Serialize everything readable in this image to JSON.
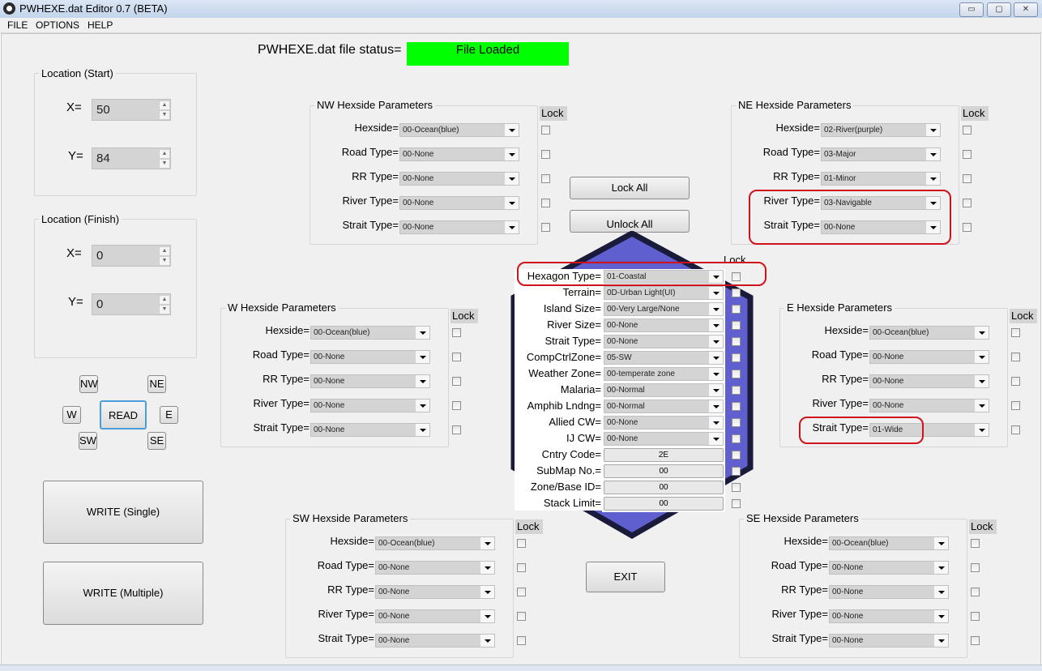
{
  "window": {
    "title": "PWHEXE.dat Editor 0.7 (BETA)",
    "minimize": "▭",
    "maximize": "▢",
    "close": "✕"
  },
  "menu": [
    "FILE",
    "OPTIONS",
    "HELP"
  ],
  "file_status": {
    "label": "PWHEXE.dat file status=",
    "value": "File Loaded",
    "color": "#00ff00"
  },
  "location_start": {
    "title": "Location (Start)",
    "x_label": "X=",
    "x": "50",
    "y_label": "Y=",
    "y": "84"
  },
  "location_finish": {
    "title": "Location (Finish)",
    "x_label": "X=",
    "x": "0",
    "y_label": "Y=",
    "y": "0"
  },
  "nav": {
    "nw": "NW",
    "ne": "NE",
    "w": "W",
    "read": "READ",
    "e": "E",
    "sw": "SW",
    "se": "SE"
  },
  "write_single": "WRITE (Single)",
  "write_multiple": "WRITE (Multiple)",
  "lock_all": "Lock All",
  "unlock_all": "Unlock All",
  "exit": "EXIT",
  "field_labels": [
    "Hexside=",
    "Road Type=",
    "RR Type=",
    "River Type=",
    "Strait Type="
  ],
  "lock_label": "Lock",
  "hexsides": {
    "nw": {
      "title": "NW Hexside Parameters",
      "values": [
        "00-Ocean(blue)",
        "00-None",
        "00-None",
        "00-None",
        "00-None"
      ]
    },
    "ne": {
      "title": "NE Hexside Parameters",
      "values": [
        "02-River(purple)",
        "03-Major",
        "01-Minor",
        "03-Navigable",
        "00-None"
      ]
    },
    "w": {
      "title": "W Hexside Parameters",
      "values": [
        "00-Ocean(blue)",
        "00-None",
        "00-None",
        "00-None",
        "00-None"
      ]
    },
    "e": {
      "title": "E Hexside Parameters",
      "values": [
        "00-Ocean(blue)",
        "00-None",
        "00-None",
        "00-None",
        "01-Wide"
      ]
    },
    "sw": {
      "title": "SW Hexside Parameters",
      "values": [
        "00-Ocean(blue)",
        "00-None",
        "00-None",
        "00-None",
        "00-None"
      ]
    },
    "se": {
      "title": "SE Hexside Parameters",
      "values": [
        "00-Ocean(blue)",
        "00-None",
        "00-None",
        "00-None",
        "00-None"
      ]
    }
  },
  "hexagon": {
    "lock_label": "Lock",
    "combos": [
      {
        "label": "Hexagon Type=",
        "value": "01-Coastal"
      },
      {
        "label": "Terrain=",
        "value": "0D-Urban Light(UI)"
      },
      {
        "label": "Island Size=",
        "value": "00-Very Large/None"
      },
      {
        "label": "River Size=",
        "value": "00-None"
      },
      {
        "label": "Strait Type=",
        "value": "00-None"
      },
      {
        "label": "CompCtrlZone=",
        "value": "05-SW"
      },
      {
        "label": "Weather Zone=",
        "value": "00-temperate zone"
      },
      {
        "label": "Malaria=",
        "value": "00-Normal"
      },
      {
        "label": "Amphib Lndng=",
        "value": "00-Normal"
      },
      {
        "label": "Allied CW=",
        "value": "00-None"
      },
      {
        "label": "IJ CW=",
        "value": "00-None"
      }
    ],
    "fields": [
      {
        "label": "Cntry Code=",
        "value": "2E"
      },
      {
        "label": "SubMap No.=",
        "value": "00"
      },
      {
        "label": "Zone/Base ID=",
        "value": "00"
      },
      {
        "label": "Stack Limit=",
        "value": "00"
      }
    ]
  },
  "colors": {
    "hexagon_fill": "#5f5fd0",
    "hexagon_border": "#1a1a3a",
    "highlight": "#d0121b"
  }
}
